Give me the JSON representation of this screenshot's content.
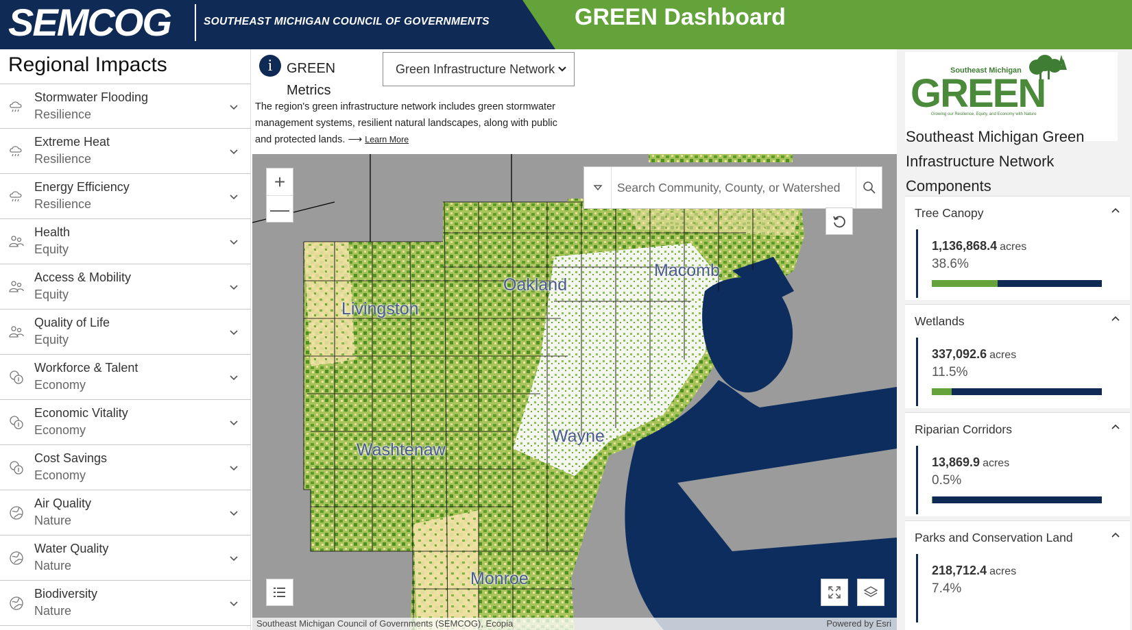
{
  "header": {
    "logo_text": "SEMCOG",
    "logo_subtitle": "SOUTHEAST MICHIGAN COUNCIL OF GOVERNMENTS",
    "dashboard_title": "GREEN Dashboard"
  },
  "sidebar": {
    "title": "Regional Impacts",
    "items": [
      {
        "name": "Stormwater Flooding",
        "category": "Resilience",
        "icon": "resilience-icon"
      },
      {
        "name": "Extreme Heat",
        "category": "Resilience",
        "icon": "resilience-icon"
      },
      {
        "name": "Energy Efficiency",
        "category": "Resilience",
        "icon": "resilience-icon"
      },
      {
        "name": "Health",
        "category": "Equity",
        "icon": "equity-icon"
      },
      {
        "name": "Access & Mobility",
        "category": "Equity",
        "icon": "equity-icon"
      },
      {
        "name": "Quality of Life",
        "category": "Equity",
        "icon": "equity-icon"
      },
      {
        "name": "Workforce & Talent",
        "category": "Economy",
        "icon": "economy-icon"
      },
      {
        "name": "Economic Vitality",
        "category": "Economy",
        "icon": "economy-icon"
      },
      {
        "name": "Cost Savings",
        "category": "Economy",
        "icon": "economy-icon"
      },
      {
        "name": "Air Quality",
        "category": "Nature",
        "icon": "nature-icon"
      },
      {
        "name": "Water Quality",
        "category": "Nature",
        "icon": "nature-icon"
      },
      {
        "name": "Biodiversity",
        "category": "Nature",
        "icon": "nature-icon"
      }
    ]
  },
  "info": {
    "icon": "info-icon",
    "icon_glyph": "i",
    "title": "GREEN Metrics",
    "selected_metric": "Green Infrastructure Network",
    "description": "The region's green infrastructure network includes green stormwater management systems, resilient natural landscapes, along with public and protected lands.",
    "learn_more_arrow": "⟶",
    "learn_more": "Learn More"
  },
  "map": {
    "search_placeholder": "Search Community, County, or Watershed",
    "counties": [
      "Oakland",
      "Macomb",
      "Livingston",
      "Washtenaw",
      "Wayne",
      "Monroe"
    ],
    "attribution": "Southeast Michigan Council of Governments (SEMCOG), Ecopia",
    "powered_by": "Powered by Esri",
    "zoom_in": "+",
    "zoom_out": "—",
    "colors": {
      "land": "#f2e2a6",
      "green": "#6fa632",
      "water": "#0c2d5e",
      "urban": "#ffffff",
      "outside": "#9b9b9b"
    }
  },
  "right_panel": {
    "logo_top": "Southeast Michigan",
    "logo_word": "GREEN",
    "logo_tagline": "Growing our Resilience, Equity, and Economy with Nature",
    "title": "Southeast Michigan Green Infrastructure Network Components",
    "components": [
      {
        "name": "Tree Canopy",
        "acres": "1,136,868.4",
        "unit": "acres",
        "percent": "38.6%",
        "fraction": 0.386
      },
      {
        "name": "Wetlands",
        "acres": "337,092.6",
        "unit": "acres",
        "percent": "11.5%",
        "fraction": 0.115
      },
      {
        "name": "Riparian Corridors",
        "acres": "13,869.9",
        "unit": "acres",
        "percent": "0.5%",
        "fraction": 0.005
      },
      {
        "name": "Parks and Conservation Land",
        "acres": "218,712.4",
        "unit": "acres",
        "percent": "7.4%",
        "fraction": 0.074
      }
    ]
  },
  "colors": {
    "navy": "#0f2a55",
    "green": "#64a23a"
  }
}
